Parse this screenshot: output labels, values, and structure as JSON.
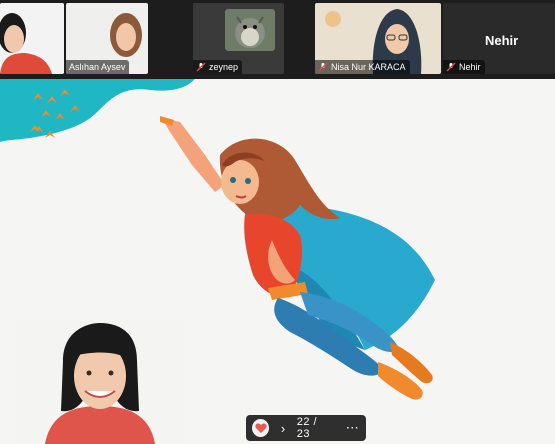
{
  "participants": [
    {
      "id": "p0",
      "name": "",
      "muted": false
    },
    {
      "id": "p1",
      "name": "Aslıhan Aysev",
      "muted": false
    },
    {
      "id": "p2",
      "name": "zeynep",
      "muted": true
    },
    {
      "id": "p3",
      "name": "Nisa Nur KARACA",
      "muted": true
    },
    {
      "id": "p4",
      "name": "Nehir",
      "muted": true,
      "display_label": "Nehir"
    }
  ],
  "controls": {
    "page_counter": "22 / 23",
    "next_glyph": "›",
    "more_glyph": "⋯",
    "reaction_icon": "heart-icon"
  },
  "colors": {
    "wave": "#1fb7c4",
    "cape": "#2aa9cf",
    "suit_red": "#e8452d",
    "hair": "#b05a35",
    "accent_border": "#2bd4c6"
  }
}
